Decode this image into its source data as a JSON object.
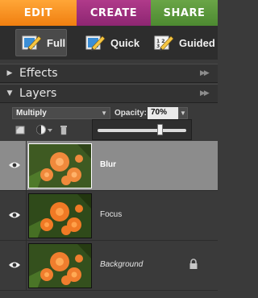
{
  "tabs": [
    {
      "label": "EDIT"
    },
    {
      "label": "CREATE"
    },
    {
      "label": "SHARE"
    }
  ],
  "modes": {
    "full": "Full",
    "quick": "Quick",
    "guided": "Guided"
  },
  "panels": {
    "effects": "Effects",
    "layers": "Layers"
  },
  "layer_controls": {
    "blend_mode": "Multiply",
    "opacity_label": "Opacity:",
    "opacity_value": "70%",
    "opacity_fraction": 0.7
  },
  "layers": [
    {
      "name": "Blur",
      "selected": true,
      "visible": true,
      "locked": false
    },
    {
      "name": "Focus",
      "selected": false,
      "visible": true,
      "locked": false
    },
    {
      "name": "Background",
      "selected": false,
      "visible": true,
      "locked": true
    }
  ],
  "colors": {
    "edit_tab": "#f07f10",
    "create_tab": "#8d2672",
    "share_tab": "#4d8a31",
    "selected_layer": "#8c8c8c"
  },
  "icons": {
    "mode": "pencil-icon",
    "visibility": "eye-icon",
    "lock": "lock-icon",
    "new_layer": "new-layer-icon",
    "adjustment": "adjustment-layer-icon",
    "delete": "trash-icon"
  }
}
